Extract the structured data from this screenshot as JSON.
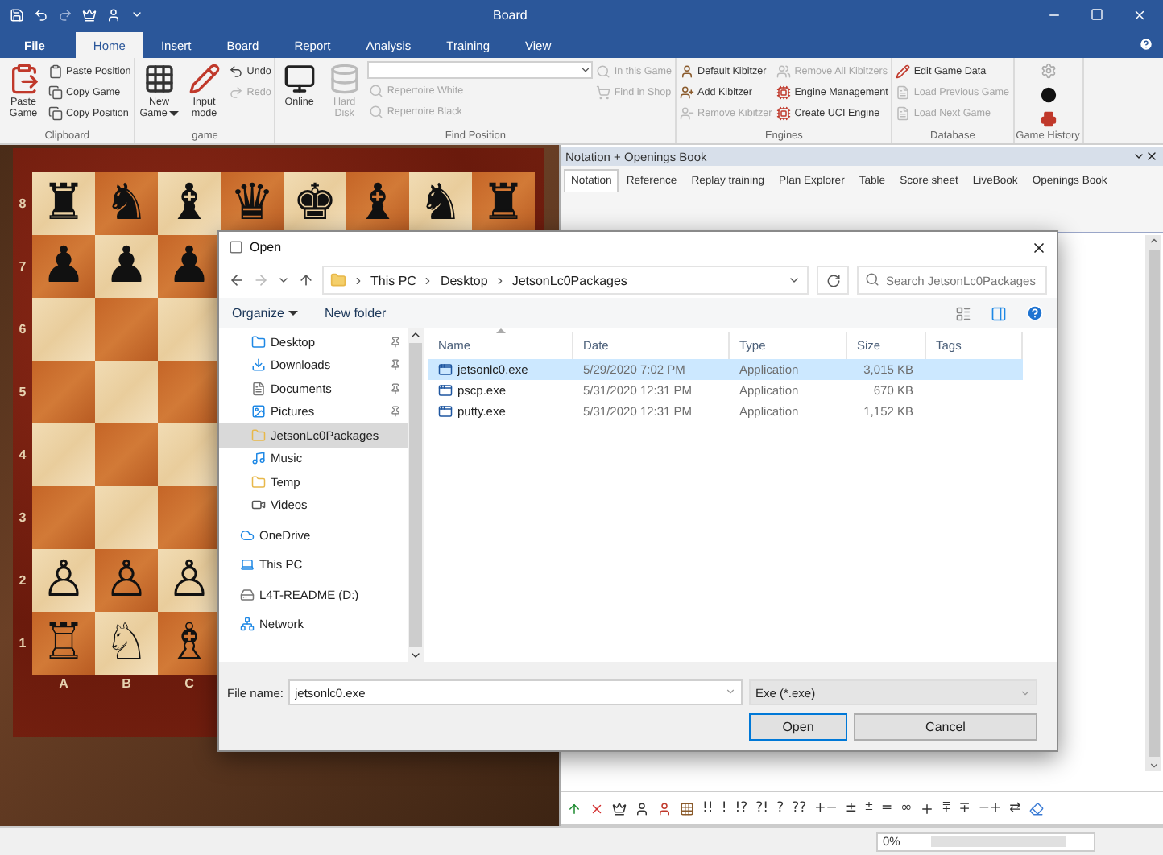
{
  "window": {
    "title": "Board"
  },
  "ribbon_tabs": [
    {
      "label": "File",
      "selected": false,
      "kind": "file"
    },
    {
      "label": "Home",
      "selected": true,
      "kind": "tab"
    },
    {
      "label": "Insert",
      "selected": false,
      "kind": "tab"
    },
    {
      "label": "Board",
      "selected": false,
      "kind": "tab"
    },
    {
      "label": "Report",
      "selected": false,
      "kind": "tab"
    },
    {
      "label": "Analysis",
      "selected": false,
      "kind": "tab"
    },
    {
      "label": "Training",
      "selected": false,
      "kind": "tab"
    },
    {
      "label": "View",
      "selected": false,
      "kind": "tab"
    }
  ],
  "ribbon_groups": [
    {
      "label": "Clipboard",
      "columns": [
        {
          "kind": "large",
          "items": [
            {
              "label": "Paste Game",
              "disabled": false
            }
          ]
        },
        {
          "kind": "small",
          "items": [
            {
              "label": "Paste Position",
              "disabled": false
            },
            {
              "label": "Copy Game",
              "disabled": false
            },
            {
              "label": "Copy Position",
              "disabled": false
            }
          ]
        }
      ]
    },
    {
      "label": "game",
      "columns": [
        {
          "kind": "large",
          "items": [
            {
              "label": "New Game",
              "disabled": false,
              "dropdown": true
            }
          ]
        },
        {
          "kind": "large",
          "items": [
            {
              "label": "Input mode",
              "disabled": false
            }
          ]
        },
        {
          "kind": "small",
          "items": [
            {
              "label": "Undo",
              "disabled": false
            },
            {
              "label": "Redo",
              "disabled": true
            }
          ]
        }
      ]
    },
    {
      "label": "Find Position",
      "columns": [
        {
          "kind": "large",
          "items": [
            {
              "label": "Online",
              "disabled": false
            }
          ]
        },
        {
          "kind": "large",
          "items": [
            {
              "label": "Hard Disk",
              "disabled": true
            }
          ]
        },
        {
          "kind": "search",
          "items": [
            {
              "label": "Repertoire White",
              "disabled": true
            },
            {
              "label": "Repertoire Black",
              "disabled": true
            }
          ]
        },
        {
          "kind": "small",
          "items": [
            {
              "label": "In this Game",
              "disabled": true
            },
            {
              "label": "Find in Shop",
              "disabled": true
            }
          ]
        }
      ]
    },
    {
      "label": "Engines",
      "columns": [
        {
          "kind": "small",
          "items": [
            {
              "label": "Default Kibitzer",
              "disabled": false
            },
            {
              "label": "Add Kibitzer",
              "disabled": false
            },
            {
              "label": "Remove Kibitzer",
              "disabled": true
            }
          ]
        },
        {
          "kind": "small",
          "items": [
            {
              "label": "Remove All Kibitzers",
              "disabled": true
            },
            {
              "label": "Engine Management",
              "disabled": false
            },
            {
              "label": "Create UCI Engine",
              "disabled": false
            }
          ]
        }
      ]
    },
    {
      "label": "Database",
      "columns": [
        {
          "kind": "small",
          "items": [
            {
              "label": "Edit Game Data",
              "disabled": false
            },
            {
              "label": "Load Previous Game",
              "disabled": true
            },
            {
              "label": "Load Next Game",
              "disabled": true
            }
          ]
        }
      ]
    },
    {
      "label": "Game History",
      "columns": [
        {
          "kind": "icons",
          "items": [
            {
              "disabled": true
            },
            {
              "disabled": false
            },
            {
              "disabled": false
            }
          ]
        }
      ]
    }
  ],
  "board": {
    "ranks": [
      {
        "label": "8",
        "pieces": [
          "♜",
          "♞",
          "♝",
          "♛",
          "♚",
          "♝",
          "♞",
          "♜"
        ]
      },
      {
        "label": "7",
        "pieces": [
          "♟",
          "♟",
          "♟"
        ]
      },
      {
        "label": "6"
      },
      {
        "label": "5"
      },
      {
        "label": "4"
      },
      {
        "label": "3"
      },
      {
        "label": "2",
        "pieces": [
          "♙",
          "♙",
          "♙"
        ]
      },
      {
        "label": "1",
        "pieces": [
          "♖",
          "♘",
          "♗"
        ]
      }
    ],
    "files": [
      "A",
      "B",
      "C"
    ]
  },
  "panel": {
    "title": "Notation + Openings Book",
    "tabs": [
      {
        "label": "Notation",
        "selected": true
      },
      {
        "label": "Reference",
        "selected": false
      },
      {
        "label": "Replay training",
        "selected": false
      },
      {
        "label": "Plan Explorer",
        "selected": false
      },
      {
        "label": "Table",
        "selected": false
      },
      {
        "label": "Score sheet",
        "selected": false
      },
      {
        "label": "LiveBook",
        "selected": false
      },
      {
        "label": "Openings Book",
        "selected": false
      }
    ],
    "symbols": [
      "!!",
      "!",
      "!?",
      "?!",
      "?",
      "??",
      "+−",
      "±",
      "⩲",
      "=",
      "∞",
      "⩱",
      "∓",
      "−+",
      "⇄"
    ]
  },
  "status_bar": {
    "progress_label": "0%",
    "level": 0
  },
  "dialog": {
    "title": "Open",
    "breadcrumbs": [
      "This PC",
      "Desktop",
      "JetsonLc0Packages"
    ],
    "search": {
      "placeholder": "Search JetsonLc0Packages"
    },
    "toolbar": [
      {
        "label": "Organize",
        "dropdown": true
      },
      {
        "label": "New folder",
        "dropdown": false
      }
    ],
    "nav_items": [
      {
        "label": "Desktop",
        "kind": "quick",
        "pinned": true,
        "selected": false
      },
      {
        "label": "Downloads",
        "kind": "quick",
        "pinned": true,
        "selected": false
      },
      {
        "label": "Documents",
        "kind": "quick",
        "pinned": true,
        "selected": false
      },
      {
        "label": "Pictures",
        "kind": "quick",
        "pinned": true,
        "selected": false
      },
      {
        "label": "JetsonLc0Packages",
        "kind": "quick",
        "pinned": false,
        "selected": true
      },
      {
        "label": "Music",
        "kind": "quick",
        "pinned": false,
        "selected": false
      },
      {
        "label": "Temp",
        "kind": "quick",
        "pinned": false,
        "selected": false
      },
      {
        "label": "Videos",
        "kind": "quick",
        "pinned": false,
        "selected": false
      },
      {
        "label": "OneDrive",
        "kind": "root",
        "pinned": false,
        "selected": false
      },
      {
        "label": "This PC",
        "kind": "root",
        "pinned": false,
        "selected": false
      },
      {
        "label": "L4T-README (D:)",
        "kind": "root",
        "pinned": false,
        "selected": false
      },
      {
        "label": "Network",
        "kind": "root",
        "pinned": false,
        "selected": false
      }
    ],
    "columns": [
      "Name",
      "Date",
      "Type",
      "Size",
      "Tags"
    ],
    "files": [
      {
        "name": "jetsonlc0.exe",
        "date": "5/29/2020 7:02 PM",
        "type": "Application",
        "size": "3,015 KB",
        "selected": true
      },
      {
        "name": "pscp.exe",
        "date": "5/31/2020 12:31 PM",
        "type": "Application",
        "size": "670 KB",
        "selected": false
      },
      {
        "name": "putty.exe",
        "date": "5/31/2020 12:31 PM",
        "type": "Application",
        "size": "1,152 KB",
        "selected": false
      }
    ],
    "file_name": {
      "label": "File name:",
      "value": "jetsonlc0.exe"
    },
    "filter": "Exe (*.exe)",
    "buttons": [
      {
        "label": "Open",
        "default": true
      },
      {
        "label": "Cancel",
        "default": false
      }
    ]
  }
}
